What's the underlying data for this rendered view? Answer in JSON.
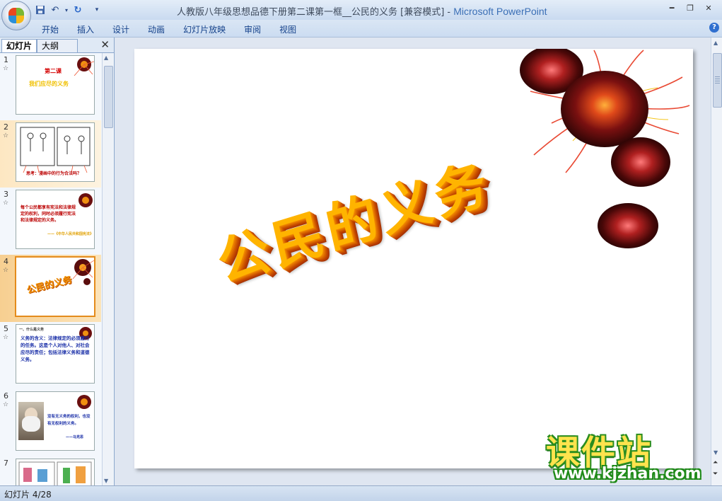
{
  "window": {
    "title": "人教版八年级思想品德下册第二课第一框__公民的义务 [兼容模式]",
    "separator": " - ",
    "app_name": "Microsoft PowerPoint",
    "controls": [
      "minimize-icon",
      "restore-icon",
      "close-icon"
    ]
  },
  "quick_access": [
    "save-icon",
    "undo-icon",
    "redo-icon",
    "customize-icon"
  ],
  "ribbon": {
    "tabs": [
      "开始",
      "插入",
      "设计",
      "动画",
      "幻灯片放映",
      "审阅",
      "视图"
    ]
  },
  "left_pane": {
    "tab_slides": "幻灯片",
    "tab_outline": "大纲",
    "slides": [
      {
        "num": "1",
        "title": "第二课",
        "subtitle": "我们应尽的义务"
      },
      {
        "num": "2",
        "caption": "思考：漫画中的行为合法吗？"
      },
      {
        "num": "3",
        "text": "每个公民都享有宪法和法律规定的权利，同时必须履行宪法和法律规定的义务。",
        "source": "——《中华人民共和国宪法》"
      },
      {
        "num": "4",
        "title": "公民的义务"
      },
      {
        "num": "5",
        "heading": "一、什么是义务",
        "body": "义务的含义：法律规定的必须履行的任务。这是个人对他人、对社会应尽的责任；包括法律义务和道德义务。"
      },
      {
        "num": "6",
        "quote": "没有无义务的权利，也没有无权利的义务。",
        "author": "——马克思"
      },
      {
        "num": "7"
      }
    ],
    "selected_index": 3
  },
  "slide": {
    "title": "公民的义务"
  },
  "status": {
    "slide_counter": "幻灯片 4/28"
  },
  "watermark": {
    "name": "课件站",
    "url": "www.kjzhan.com"
  },
  "colors": {
    "title_gold": "#ffb400",
    "title_shadow": "#c84e00",
    "selection": "#f7cf91",
    "watermark_green": "#2a8d1f",
    "watermark_yellow": "#ffe34d"
  }
}
